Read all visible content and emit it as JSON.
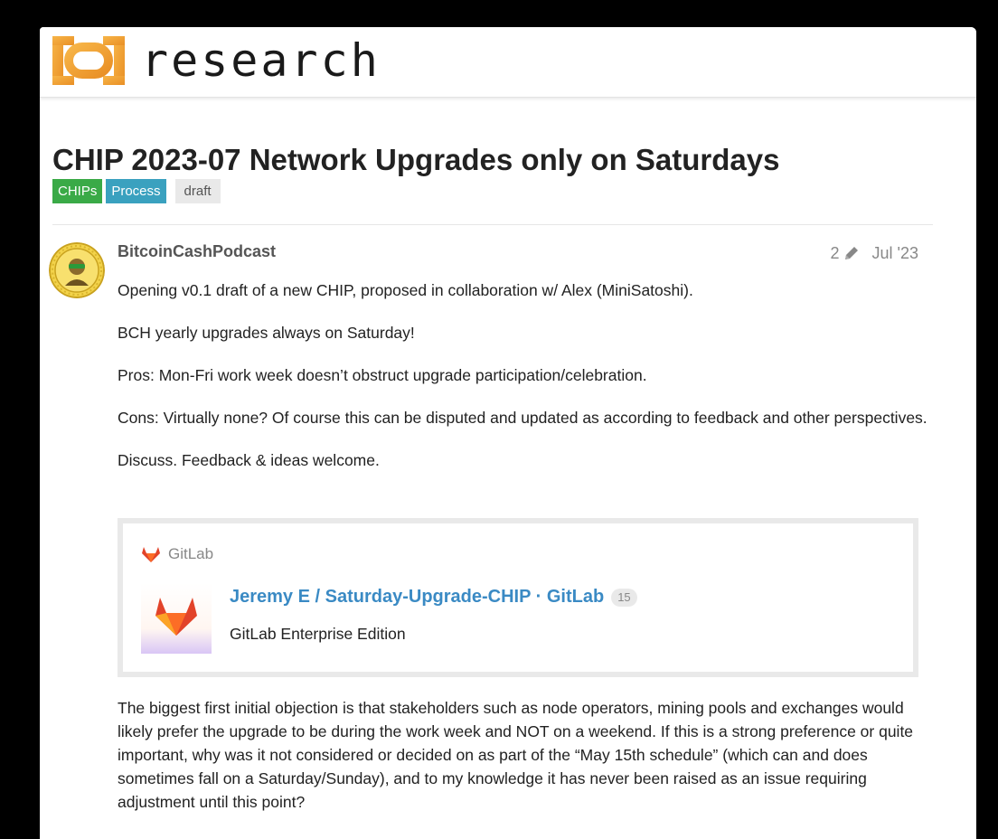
{
  "header": {
    "logo_text": "research"
  },
  "topic": {
    "title": "CHIP 2023-07 Network Upgrades only on Saturdays",
    "tags": [
      "CHIPs",
      "Process",
      "draft"
    ]
  },
  "post": {
    "username": "BitcoinCashPodcast",
    "edit_count": "2",
    "date": "Jul '23",
    "paragraphs": [
      "Opening v0.1 draft of a new CHIP, proposed in collaboration w/ Alex (MiniSatoshi).",
      "BCH yearly upgrades always on Saturday!",
      "Pros: Mon-Fri work week doesn’t obstruct upgrade participation/celebration.",
      "Cons: Virtually none? Of course this can be disputed and updated as according to feedback and other perspectives.",
      "Discuss. Feedback & ideas welcome."
    ],
    "onebox": {
      "source": "GitLab",
      "title": "Jeremy E / Saturday-Upgrade-CHIP · GitLab",
      "click_count": "15",
      "description": "GitLab Enterprise Edition"
    },
    "closing_paragraph": "The biggest first initial objection is that stakeholders such as node operators, mining pools and exchanges would likely prefer the upgrade to be during the work week and NOT on a weekend. If this is a strong preference or quite important, why was it not considered or decided on as part of the “May 15th schedule” (which can and does sometimes fall on a Saturday/Sunday), and to my knowledge it has never been raised as an issue requiring adjustment until this point?"
  },
  "colors": {
    "logo_orange": "#f0a437",
    "tag_chips": "#3aaa47",
    "tag_process": "#3aa1bf",
    "link_blue": "#3a8ac4",
    "gitlab_orange": "#e24329"
  },
  "icons": [
    "logo-icon",
    "avatar",
    "pencil-icon",
    "gitlab-icon",
    "gitlab-thumbnail"
  ]
}
